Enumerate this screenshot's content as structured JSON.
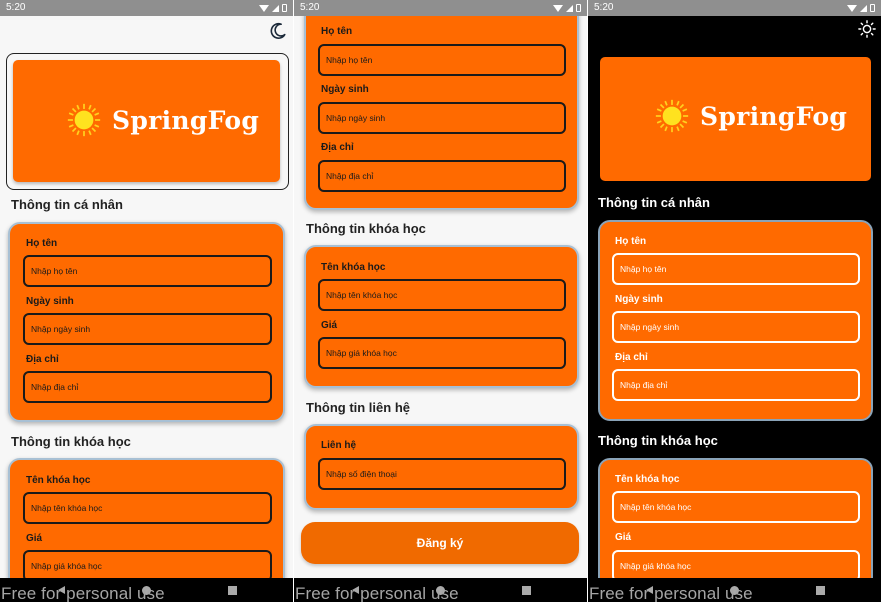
{
  "status_bar": {
    "time": "5:20"
  },
  "brand": {
    "name": "SpringFog"
  },
  "sections": {
    "personal": "Thông tin cá nhân",
    "course": "Thông tin khóa học",
    "contact": "Thông tin liên hệ"
  },
  "fields": {
    "full_name": {
      "label": "Họ tên",
      "placeholder": "Nhập họ tên"
    },
    "birth_date": {
      "label": "Ngày sinh",
      "placeholder": "Nhập ngày sinh"
    },
    "address": {
      "label": "Địa chỉ",
      "placeholder": "Nhập địa chỉ"
    },
    "course_name": {
      "label": "Tên khóa học",
      "placeholder": "Nhập tên khóa học"
    },
    "price": {
      "label": "Giá",
      "placeholder": "Nhập giá khóa học"
    },
    "contact": {
      "label": "Liên hệ",
      "placeholder": "Nhập số điện thoại"
    }
  },
  "submit": {
    "label": "Đăng ký"
  },
  "watermark": "Free for personal use",
  "theme": {
    "accent": "#ff6a00",
    "button": "#f06a00",
    "light_bg": "#f7f7f7",
    "dark_bg": "#000000"
  },
  "icons": {
    "light_toggle": "moon-icon",
    "dark_toggle": "sun-icon"
  }
}
